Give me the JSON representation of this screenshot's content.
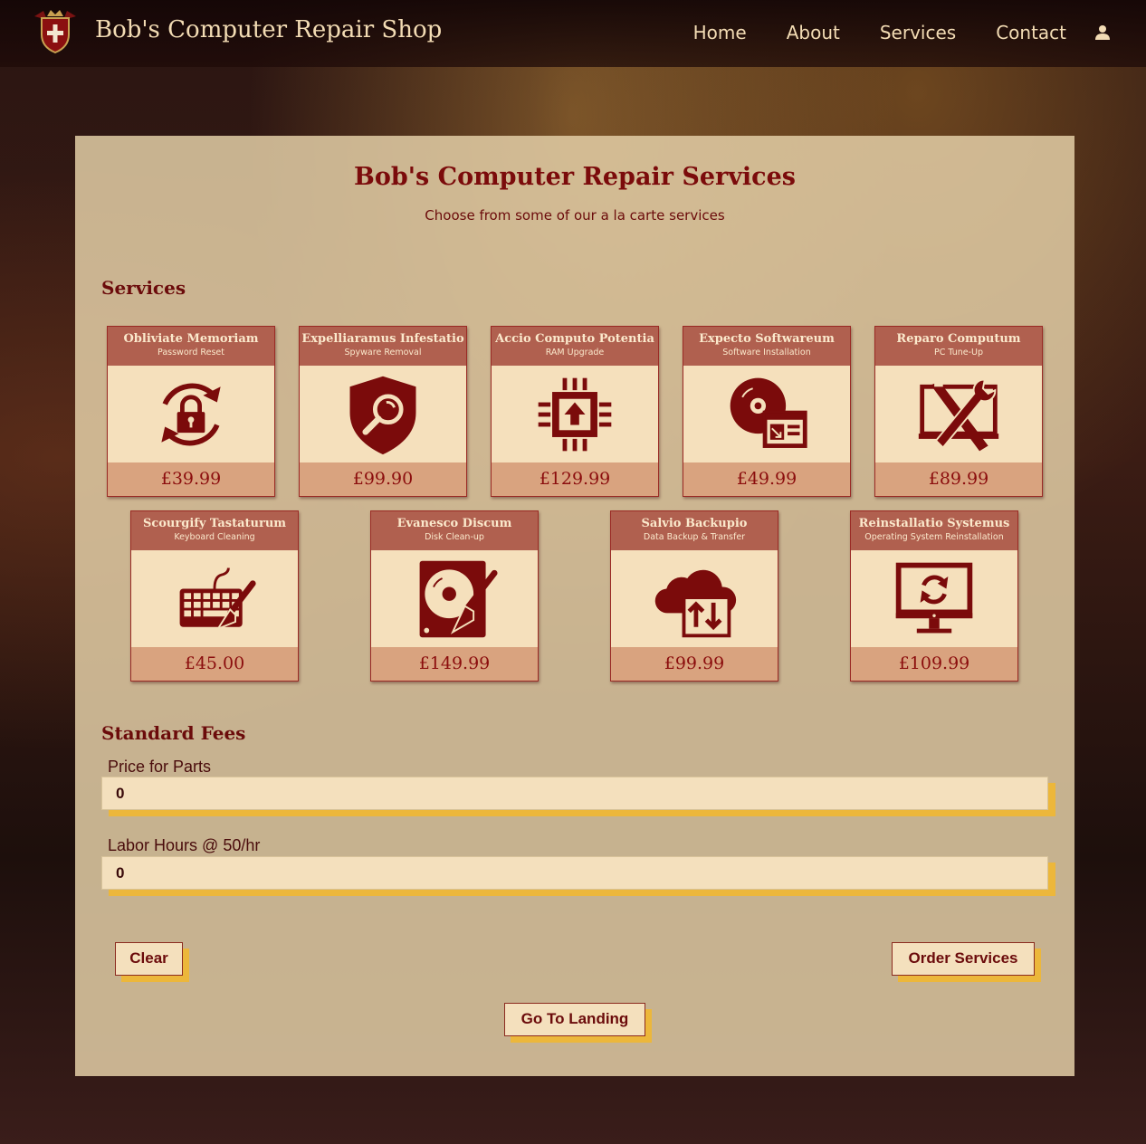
{
  "nav": {
    "brand": "Bob's Computer Repair Shop",
    "links": [
      "Home",
      "About",
      "Services",
      "Contact"
    ]
  },
  "header": {
    "title": "Bob's Computer Repair Services",
    "subtitle": "Choose from some of our a la carte services"
  },
  "services_heading": "Services",
  "services": [
    {
      "title": "Obliviate Memoriam",
      "subtitle": "Password Reset",
      "price": "£39.99",
      "icon": "lock-refresh-icon"
    },
    {
      "title": "Expelliaramus Infestatio",
      "subtitle": "Spyware Removal",
      "price": "£99.90",
      "icon": "shield-search-icon"
    },
    {
      "title": "Accio Computo Potentia",
      "subtitle": "RAM Upgrade",
      "price": "£129.99",
      "icon": "chip-upgrade-icon"
    },
    {
      "title": "Expecto Softwareum",
      "subtitle": "Software Installation",
      "price": "£49.99",
      "icon": "disc-install-icon"
    },
    {
      "title": "Reparo Computum",
      "subtitle": "PC Tune-Up",
      "price": "£89.99",
      "icon": "tools-monitor-icon"
    },
    {
      "title": "Scourgify Tastaturum",
      "subtitle": "Keyboard Cleaning",
      "price": "£45.00",
      "icon": "keyboard-brush-icon"
    },
    {
      "title": "Evanesco Discum",
      "subtitle": "Disk Clean-up",
      "price": "£149.99",
      "icon": "harddisk-brush-icon"
    },
    {
      "title": "Salvio Backupio",
      "subtitle": "Data Backup & Transfer",
      "price": "£99.99",
      "icon": "cloud-transfer-icon"
    },
    {
      "title": "Reinstallatio Systemus",
      "subtitle": "Operating System Reinstallation",
      "price": "£109.99",
      "icon": "monitor-refresh-icon"
    }
  ],
  "fees": {
    "heading": "Standard Fees",
    "parts_label": "Price for Parts",
    "parts_value": "0",
    "labor_label": "Labor Hours @ 50/hr",
    "labor_value": "0"
  },
  "buttons": {
    "clear": "Clear",
    "order": "Order Services",
    "landing": "Go To Landing"
  },
  "colors": {
    "accent": "#7b0b0b",
    "card_header": "#b0604f",
    "price_bar": "#d9a37f",
    "button_shadow": "#ecb73b"
  }
}
